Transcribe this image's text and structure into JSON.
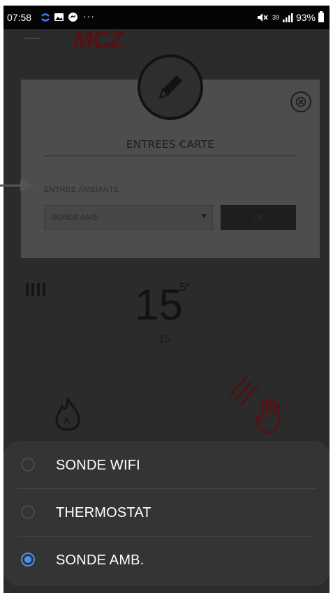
{
  "status_bar": {
    "time": "07:58",
    "icons": [
      "sync-icon",
      "image-icon",
      "messenger-icon",
      "more-icon"
    ],
    "more": "···",
    "network_small": "39",
    "battery": "93%"
  },
  "background_app": {
    "logo": "MCZ",
    "temperature": "15",
    "temperature_decimal": "5°",
    "sub_value": "15"
  },
  "dialog": {
    "title": "ENTREES CARTE",
    "field_label": "ENTREE AMBIANTE",
    "select_value": "SONDE AMB.",
    "ok_label": "OK",
    "close_icon": "⊗"
  },
  "sheet": {
    "options": [
      {
        "label": "SONDE WIFI",
        "selected": false
      },
      {
        "label": "THERMOSTAT",
        "selected": false
      },
      {
        "label": "SONDE AMB.",
        "selected": true
      }
    ]
  },
  "colors": {
    "accent": "#4a8ff7",
    "sheet_bg": "#343434",
    "status_bar": "#050505"
  }
}
